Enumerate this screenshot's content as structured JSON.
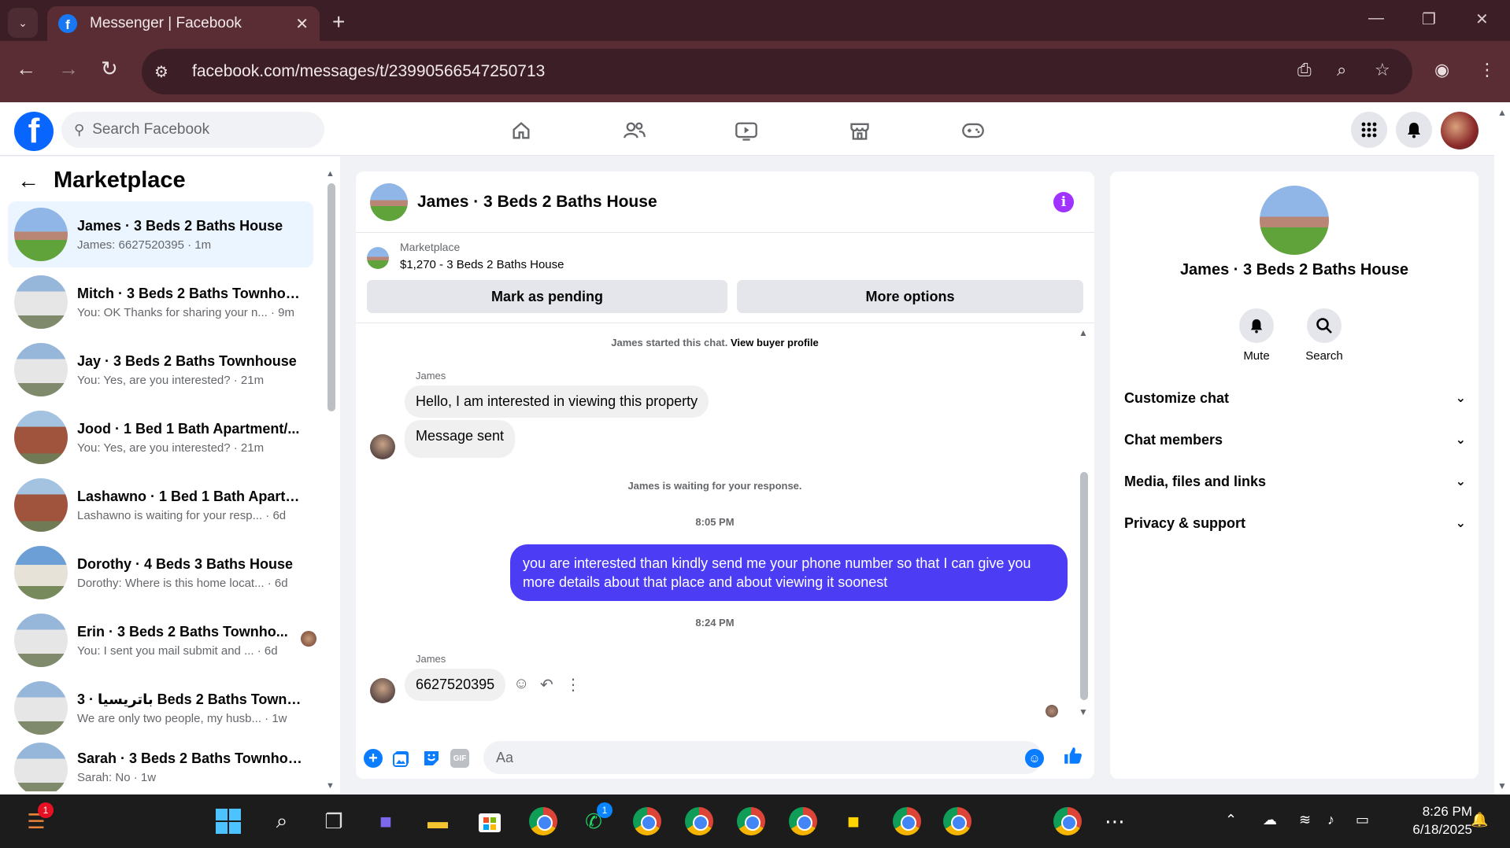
{
  "browser": {
    "tab_title": "Messenger | Facebook",
    "url": "facebook.com/messages/t/23990566547250713"
  },
  "fb": {
    "search_placeholder": "Search Facebook"
  },
  "left": {
    "title": "Marketplace",
    "conversations": [
      {
        "name": "James · 3 Beds 2 Baths House",
        "preview": "James: 6627520395 · 1m"
      },
      {
        "name": "Mitch · 3 Beds 2 Baths Townhou...",
        "preview": "You: OK Thanks for sharing your n... · 9m"
      },
      {
        "name": "Jay · 3 Beds 2 Baths Townhouse",
        "preview": "You: Yes, are you interested? · 21m"
      },
      {
        "name": "Jood · 1 Bed 1 Bath Apartment/...",
        "preview": "You: Yes, are you interested? · 21m"
      },
      {
        "name": "Lashawno · 1 Bed 1 Bath Apartm...",
        "preview": "Lashawno is waiting for your resp... · 6d"
      },
      {
        "name": "Dorothy · 4 Beds 3 Baths House",
        "preview": "Dorothy: Where is this home locat... · 6d"
      },
      {
        "name": "Erin · 3 Beds 2 Baths Townho...",
        "preview": "You: I sent you mail submit and ... · 6d"
      },
      {
        "name": "باتريسيا · 3 Beds 2 Baths Townhouse...",
        "preview": "We are only two people, my husb... · 1w"
      },
      {
        "name": "Sarah · 3 Beds 2 Baths Townhou...",
        "preview": "Sarah: No · 1w"
      }
    ]
  },
  "chat": {
    "title": "James · 3 Beds 2 Baths House",
    "listing_source": "Marketplace",
    "listing_title": "$1,270 - 3 Beds 2 Baths House",
    "mark_pending": "Mark as pending",
    "more_options": "More options",
    "system_start": "James started this chat.",
    "view_profile": "View buyer profile",
    "sender1": "James",
    "msg1": "Hello, I am interested in viewing this property",
    "msg2": "Message sent",
    "waiting": "James is waiting for your response.",
    "time1": "8:05 PM",
    "outgoing": "you are interested than kindly send me your phone number so that I can give you more details about that place and about viewing it soonest",
    "time2": "8:24 PM",
    "sender2": "James",
    "msg3": "6627520395",
    "composer_placeholder": "Aa",
    "gif_label": "GIF"
  },
  "right": {
    "name": "James · 3 Beds 2 Baths House",
    "mute": "Mute",
    "search": "Search",
    "sections": [
      "Customize chat",
      "Chat members",
      "Media, files and links",
      "Privacy & support"
    ]
  },
  "taskbar": {
    "time": "8:26 PM",
    "date": "6/18/2025",
    "badge_app": "1",
    "badge_whatsapp": "1"
  },
  "colors": {
    "accent": "#0866ff",
    "outgoing_bubble": "#4c3cf4",
    "info_icon": "#a033ff",
    "browser_frame": "#5a2d35"
  }
}
